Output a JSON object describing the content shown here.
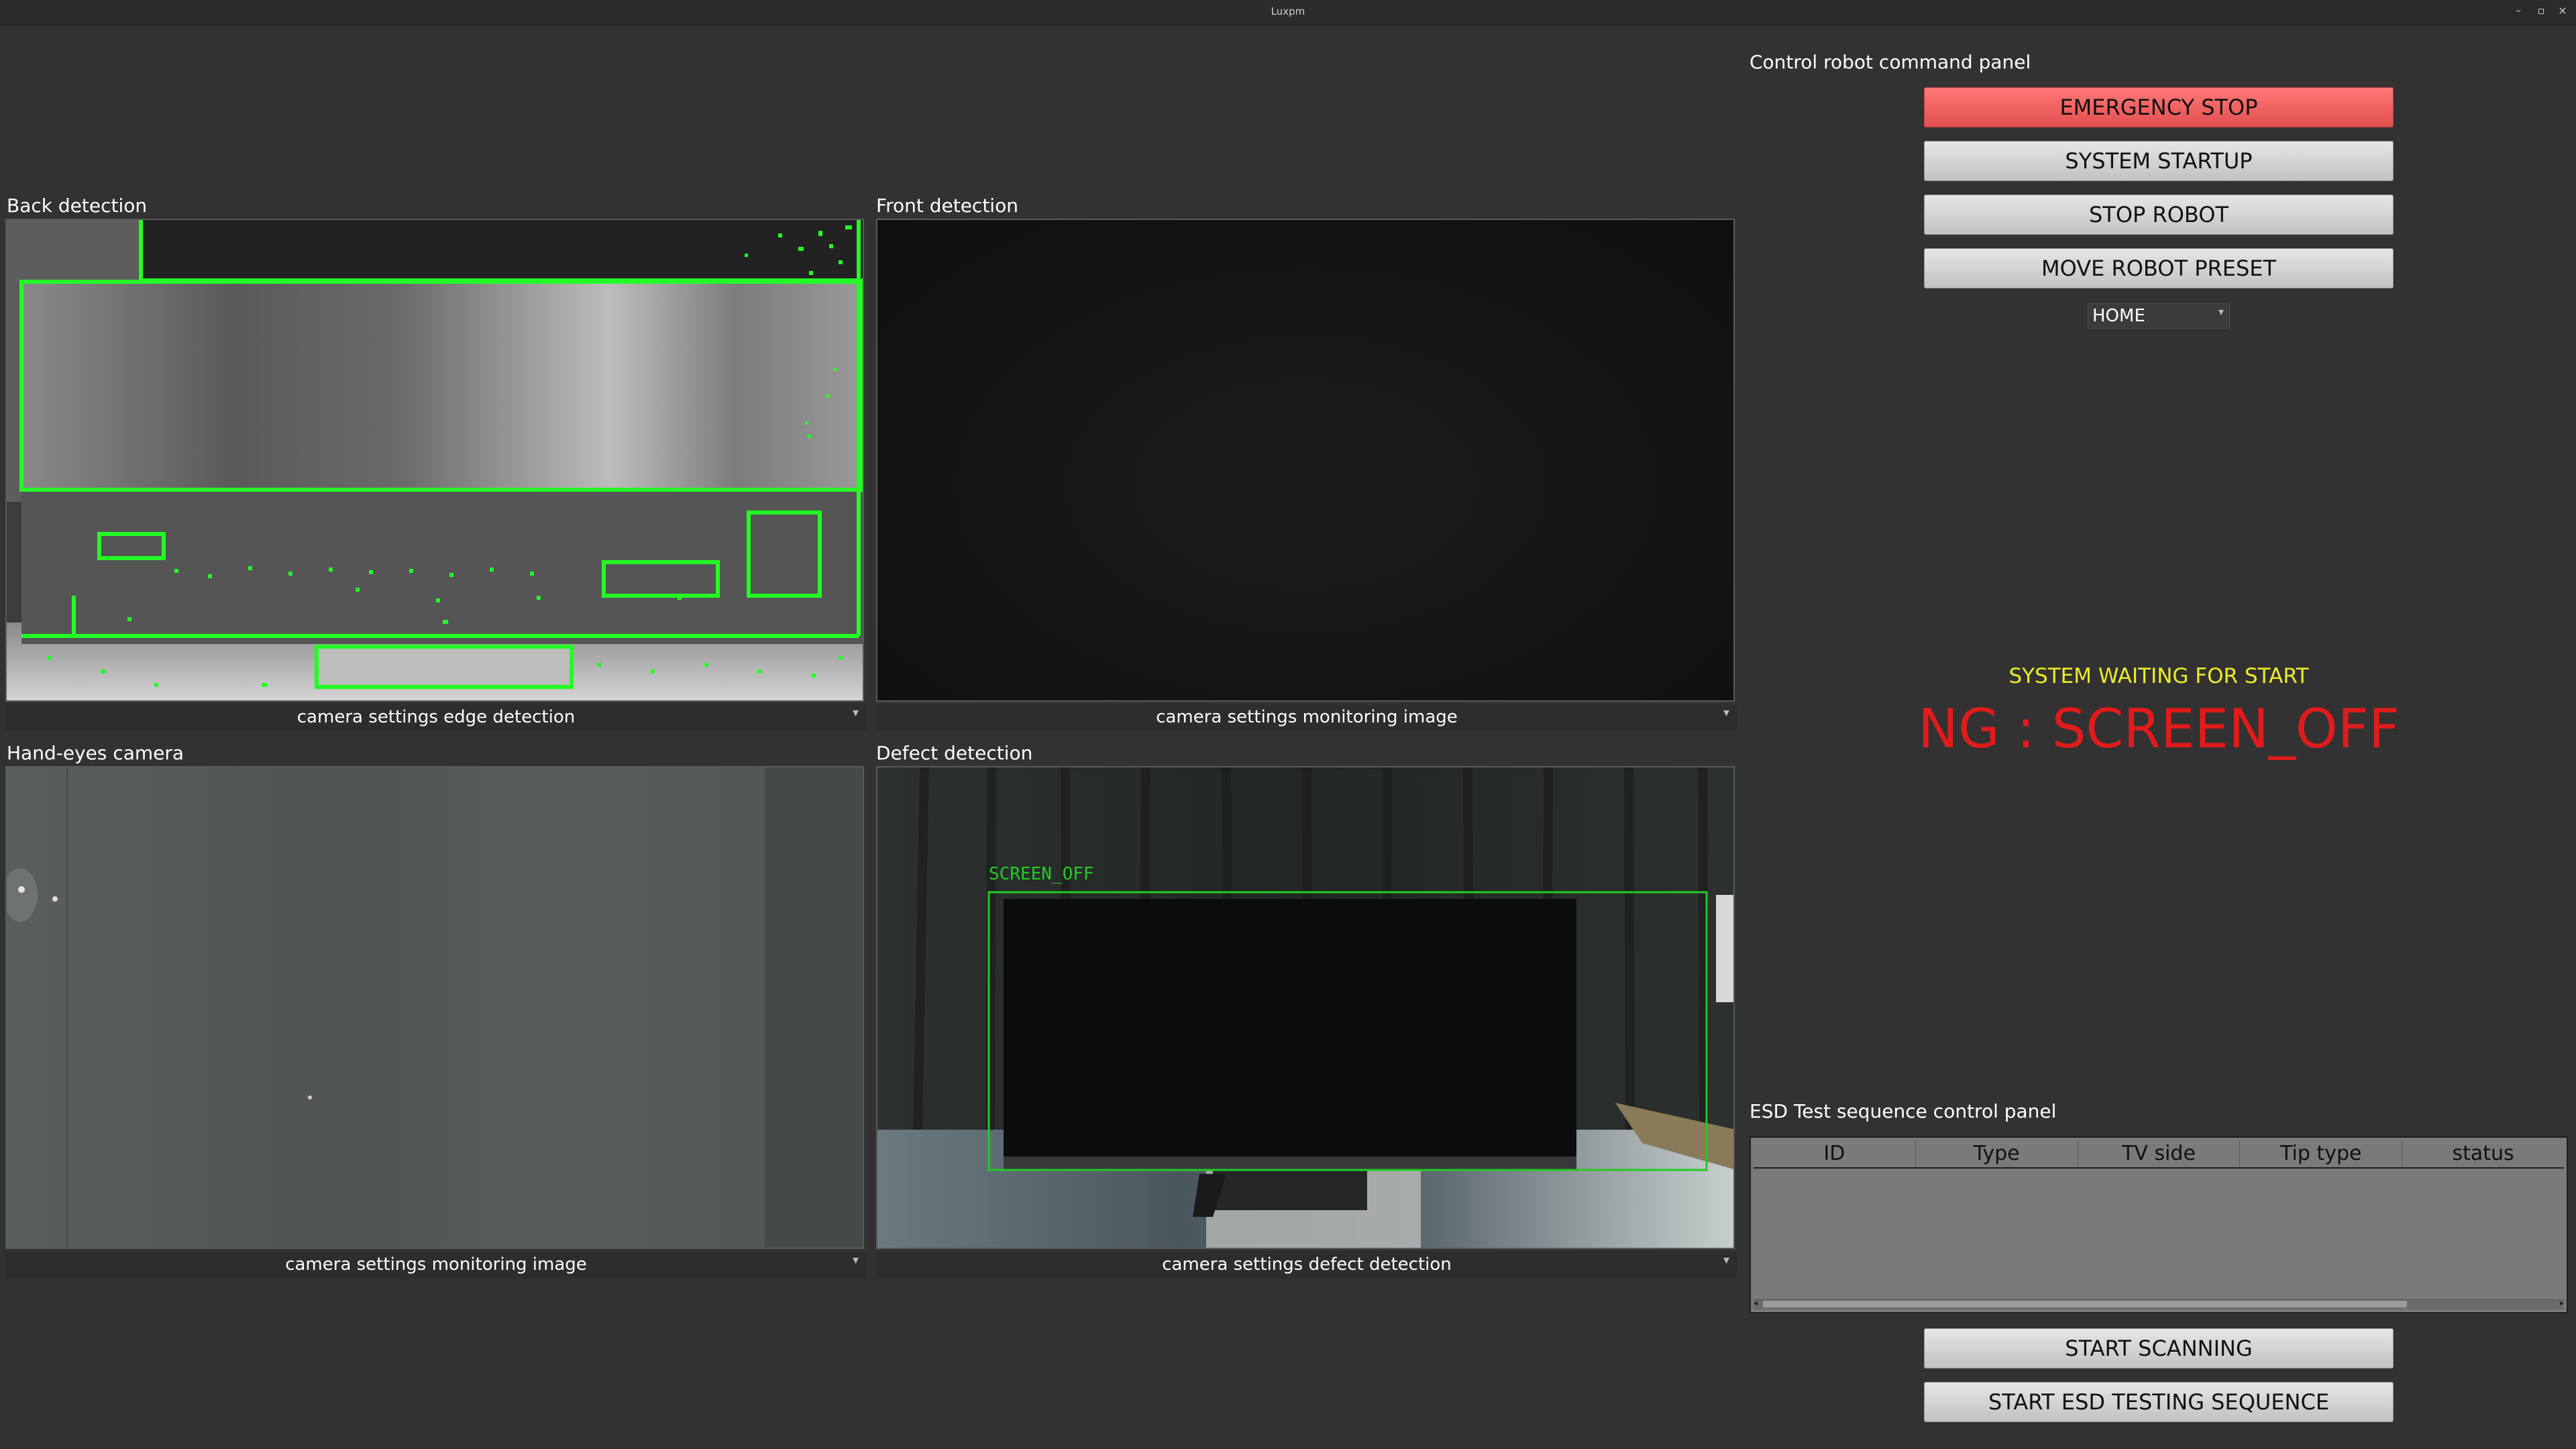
{
  "window": {
    "title": "Luxpm",
    "minimize": "–",
    "maximize": "▫",
    "close": "×"
  },
  "views": {
    "back": {
      "label": "Back detection",
      "setting": "camera settings edge detection"
    },
    "front": {
      "label": "Front detection",
      "setting": "camera settings monitoring image"
    },
    "handeye": {
      "label": "Hand-eyes camera",
      "setting": "camera settings monitoring image"
    },
    "defect": {
      "label": "Defect detection",
      "setting": "camera settings defect detection",
      "overlay_label": "SCREEN_OFF"
    }
  },
  "control_panel": {
    "title": "Control robot command panel",
    "emergency_stop": "EMERGENCY STOP",
    "system_startup": "SYSTEM STARTUP",
    "stop_robot": "STOP ROBOT",
    "move_preset": "MOVE ROBOT PRESET",
    "preset_value": "HOME"
  },
  "status": {
    "message": "SYSTEM WAITING FOR START",
    "result": "NG : SCREEN_OFF"
  },
  "esd_panel": {
    "title": "ESD Test sequence control panel",
    "columns": [
      "ID",
      "Type",
      "TV side",
      "Tip type",
      "status"
    ],
    "start_scanning": "START SCANNING",
    "start_esd": "START ESD TESTING SEQUENCE"
  },
  "icons": {
    "dropdown": "▾"
  },
  "colors": {
    "background": "#323232",
    "emergency": "#f36363",
    "status_yellow": "#ecec2a",
    "ng_red": "#e01b1b",
    "edge_green": "#22ff22",
    "defect_green": "#22cc22"
  }
}
